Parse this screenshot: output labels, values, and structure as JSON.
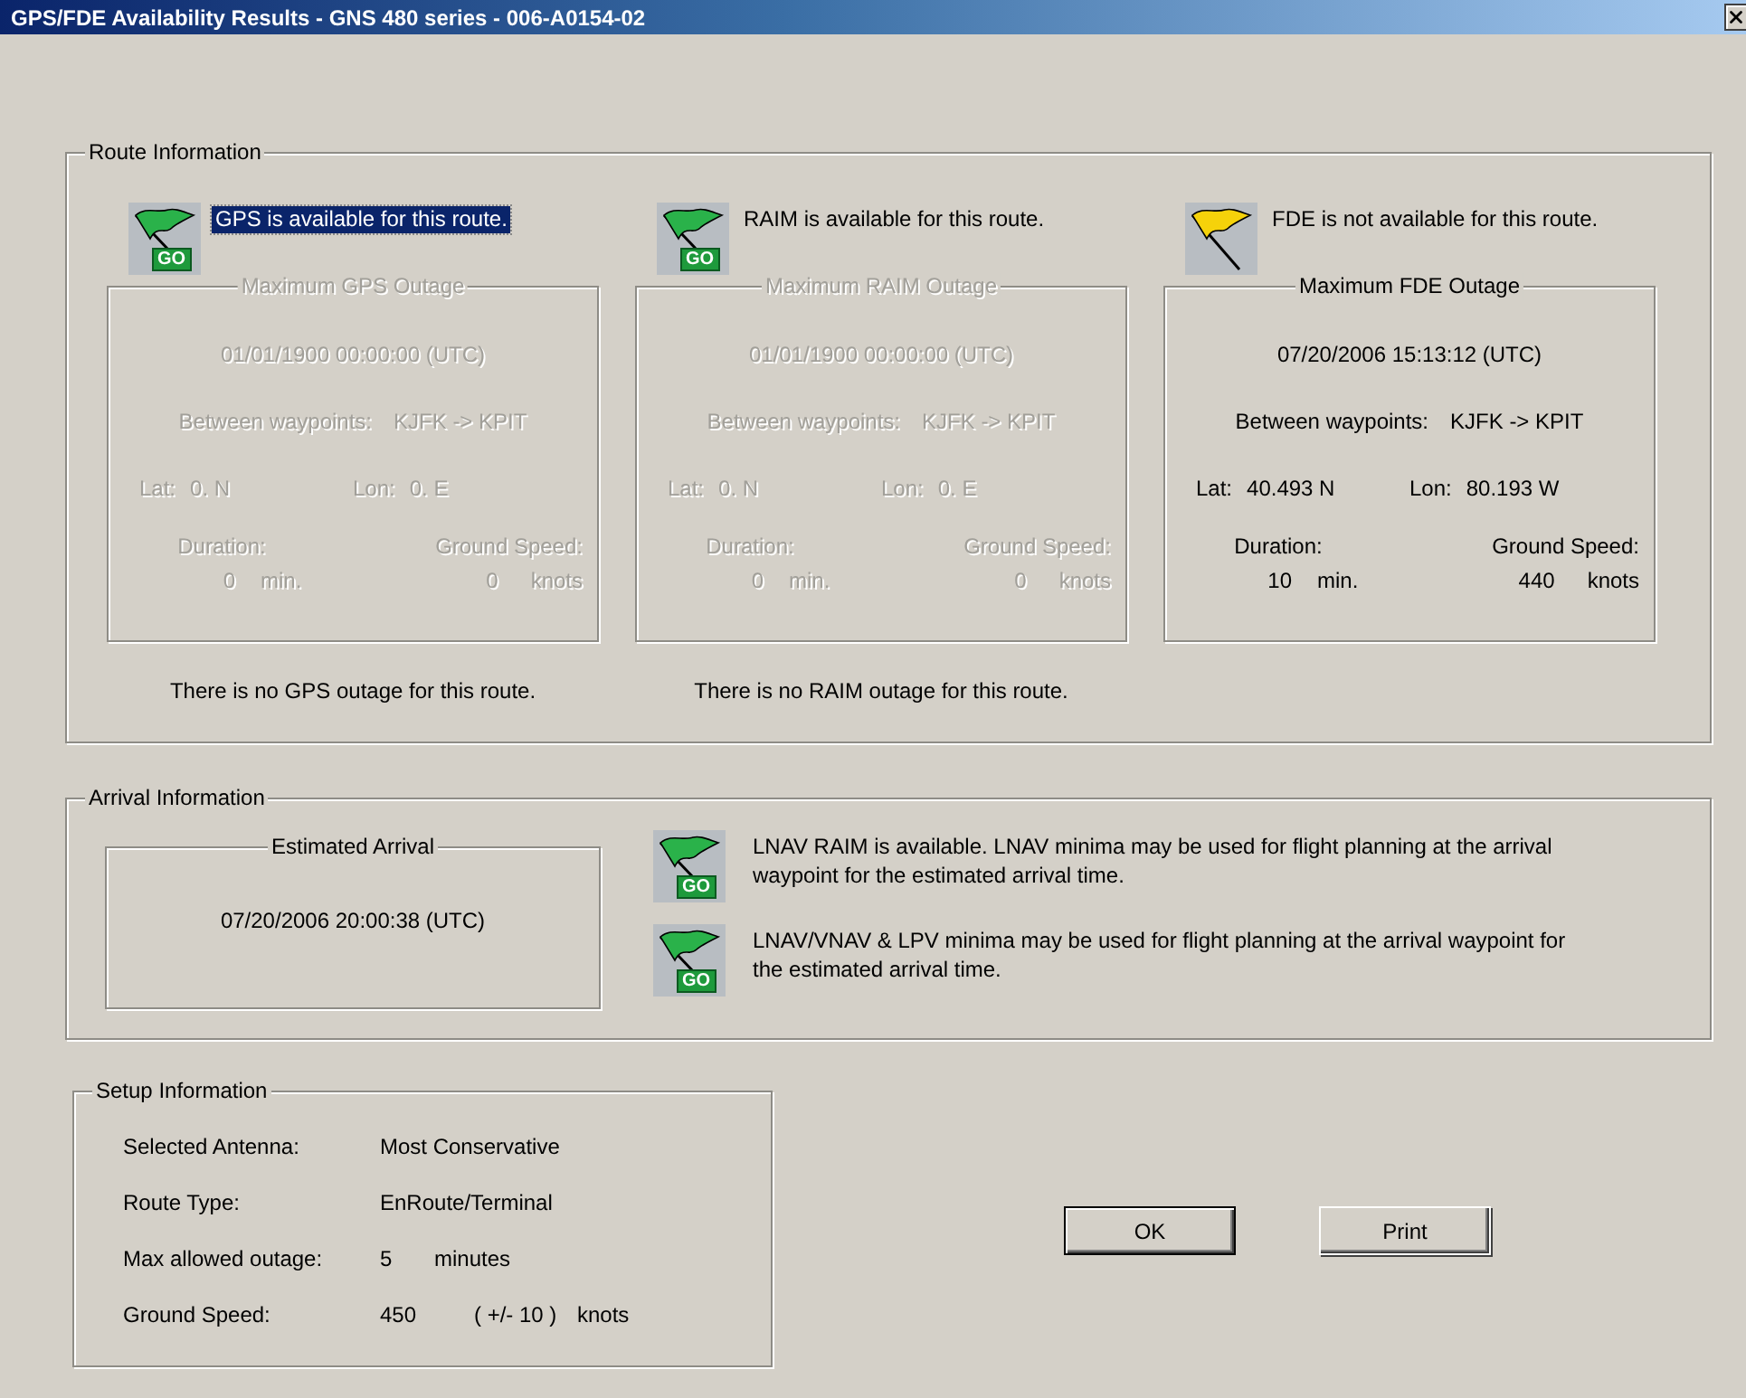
{
  "window": {
    "title": "GPS/FDE Availability Results - GNS 480 series - 006-A0154-02"
  },
  "route_information": {
    "title": "Route Information",
    "columns": [
      {
        "kind": "go",
        "badge": "GO",
        "status": "GPS is available for this route.",
        "selected": true,
        "outage": {
          "title": "Maximum GPS Outage",
          "disabled": true,
          "time": "01/01/1900 00:00:00 (UTC)",
          "waypoints_label": "Between waypoints:",
          "waypoints": "KJFK -> KPIT",
          "lat_label": "Lat:",
          "lat": "0. N",
          "lon_label": "Lon:",
          "lon": "0. E",
          "duration_label": "Duration:",
          "duration": "0",
          "duration_unit": "min.",
          "speed_label": "Ground Speed:",
          "speed": "0",
          "speed_unit": "knots"
        },
        "note": "There is no GPS outage for this route."
      },
      {
        "kind": "go",
        "badge": "GO",
        "status": "RAIM is available for this route.",
        "selected": false,
        "outage": {
          "title": "Maximum RAIM Outage",
          "disabled": true,
          "time": "01/01/1900 00:00:00 (UTC)",
          "waypoints_label": "Between waypoints:",
          "waypoints": "KJFK -> KPIT",
          "lat_label": "Lat:",
          "lat": "0. N",
          "lon_label": "Lon:",
          "lon": "0. E",
          "duration_label": "Duration:",
          "duration": "0",
          "duration_unit": "min.",
          "speed_label": "Ground Speed:",
          "speed": "0",
          "speed_unit": "knots"
        },
        "note": "There is no RAIM outage for this route."
      },
      {
        "kind": "caution",
        "status": "FDE is not available for this route.",
        "selected": false,
        "outage": {
          "title": "Maximum FDE Outage",
          "disabled": false,
          "time": "07/20/2006 15:13:12 (UTC)",
          "waypoints_label": "Between waypoints:",
          "waypoints": "KJFK -> KPIT",
          "lat_label": "Lat:",
          "lat": "40.493 N",
          "lon_label": "Lon:",
          "lon": "80.193 W",
          "duration_label": "Duration:",
          "duration": "10",
          "duration_unit": "min.",
          "speed_label": "Ground Speed:",
          "speed": "440",
          "speed_unit": "knots"
        }
      }
    ]
  },
  "arrival_information": {
    "title": "Arrival Information",
    "estimated": {
      "title": "Estimated Arrival",
      "time": "07/20/2006 20:00:38 (UTC)"
    },
    "messages": [
      {
        "kind": "go",
        "badge": "GO",
        "text": "LNAV RAIM is available. LNAV minima may be used for flight planning at the arrival waypoint for the estimated arrival time."
      },
      {
        "kind": "go",
        "badge": "GO",
        "text": "LNAV/VNAV & LPV minima may be used for flight planning at the arrival waypoint for the estimated arrival time."
      }
    ]
  },
  "setup_information": {
    "title": "Setup Information",
    "rows": [
      {
        "label": "Selected Antenna:",
        "value": "Most Conservative"
      },
      {
        "label": "Route Type:",
        "value": "EnRoute/Terminal"
      },
      {
        "label": "Max allowed outage:",
        "value": "5",
        "unit": "minutes"
      },
      {
        "label": "Ground Speed:",
        "value": "450",
        "tolerance": "( +/- 10 )",
        "unit": "knots"
      }
    ]
  },
  "buttons": [
    {
      "label": "OK",
      "default": true
    },
    {
      "label": "Print",
      "default": false
    }
  ]
}
